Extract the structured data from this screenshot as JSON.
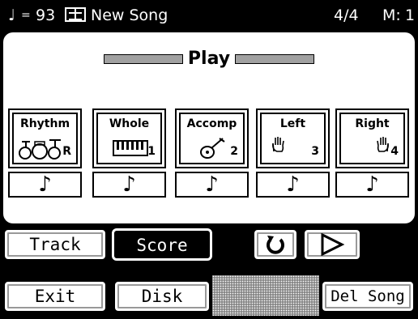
{
  "status": {
    "tempo_symbol": "♩",
    "tempo_eq": "=",
    "tempo_value": "93",
    "book_icon": "song-book-icon",
    "song_name": "New Song",
    "time_signature": "4/4",
    "measure_label": "M:",
    "measure_value": "1"
  },
  "panel": {
    "mode_title": "Play",
    "tracks": [
      {
        "label": "Rhythm",
        "icon": "drum-kit-icon",
        "num": "R",
        "glyph": "🥁"
      },
      {
        "label": "Whole",
        "icon": "keyboard-icon",
        "num": "1",
        "glyph": "𝄘"
      },
      {
        "label": "Accomp",
        "icon": "guitar-icon",
        "num": "2",
        "glyph": "🎸"
      },
      {
        "label": "Left",
        "icon": "left-hand-icon",
        "num": "3",
        "glyph": "✋"
      },
      {
        "label": "Right",
        "icon": "right-hand-icon",
        "num": "4",
        "glyph": "✋"
      }
    ],
    "note_glyph": "♪"
  },
  "buttons": {
    "track": "Track",
    "score": "Score",
    "loop_icon": "loop-icon",
    "play_icon": "play-icon",
    "exit": "Exit",
    "disk": "Disk",
    "del_song": "Del Song"
  }
}
